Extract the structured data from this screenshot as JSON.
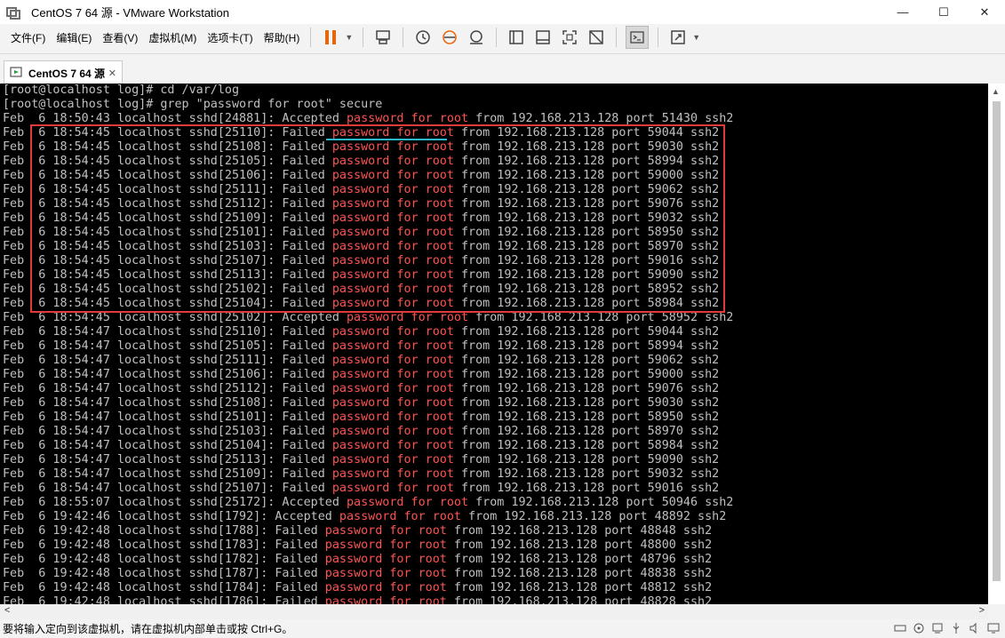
{
  "window": {
    "title": "CentOS 7 64 源 - VMware Workstation",
    "minimize_glyph": "—",
    "maximize_glyph": "☐",
    "close_glyph": "✕"
  },
  "menu": {
    "items": [
      "文件(F)",
      "编辑(E)",
      "查看(V)",
      "虚拟机(M)",
      "选项卡(T)",
      "帮助(H)"
    ]
  },
  "toolbar": {
    "dropdown_glyph": "▼"
  },
  "tab": {
    "label": "CentOS 7 64 源",
    "close": "✕"
  },
  "terminal": {
    "highlight_phrase": "password for root",
    "lines": [
      "[root@localhost log]# cd /var/log",
      "[root@localhost log]# grep \"password for root\" secure",
      "Feb  6 18:50:43 localhost sshd[24881]: Accepted password for root from 192.168.213.128 port 51430 ssh2",
      "Feb  6 18:54:45 localhost sshd[25110]: Failed password for root from 192.168.213.128 port 59044 ssh2",
      "Feb  6 18:54:45 localhost sshd[25108]: Failed password for root from 192.168.213.128 port 59030 ssh2",
      "Feb  6 18:54:45 localhost sshd[25105]: Failed password for root from 192.168.213.128 port 58994 ssh2",
      "Feb  6 18:54:45 localhost sshd[25106]: Failed password for root from 192.168.213.128 port 59000 ssh2",
      "Feb  6 18:54:45 localhost sshd[25111]: Failed password for root from 192.168.213.128 port 59062 ssh2",
      "Feb  6 18:54:45 localhost sshd[25112]: Failed password for root from 192.168.213.128 port 59076 ssh2",
      "Feb  6 18:54:45 localhost sshd[25109]: Failed password for root from 192.168.213.128 port 59032 ssh2",
      "Feb  6 18:54:45 localhost sshd[25101]: Failed password for root from 192.168.213.128 port 58950 ssh2",
      "Feb  6 18:54:45 localhost sshd[25103]: Failed password for root from 192.168.213.128 port 58970 ssh2",
      "Feb  6 18:54:45 localhost sshd[25107]: Failed password for root from 192.168.213.128 port 59016 ssh2",
      "Feb  6 18:54:45 localhost sshd[25113]: Failed password for root from 192.168.213.128 port 59090 ssh2",
      "Feb  6 18:54:45 localhost sshd[25102]: Failed password for root from 192.168.213.128 port 58952 ssh2",
      "Feb  6 18:54:45 localhost sshd[25104]: Failed password for root from 192.168.213.128 port 58984 ssh2",
      "Feb  6 18:54:45 localhost sshd[25102]: Accepted password for root from 192.168.213.128 port 58952 ssh2",
      "Feb  6 18:54:47 localhost sshd[25110]: Failed password for root from 192.168.213.128 port 59044 ssh2",
      "Feb  6 18:54:47 localhost sshd[25105]: Failed password for root from 192.168.213.128 port 58994 ssh2",
      "Feb  6 18:54:47 localhost sshd[25111]: Failed password for root from 192.168.213.128 port 59062 ssh2",
      "Feb  6 18:54:47 localhost sshd[25106]: Failed password for root from 192.168.213.128 port 59000 ssh2",
      "Feb  6 18:54:47 localhost sshd[25112]: Failed password for root from 192.168.213.128 port 59076 ssh2",
      "Feb  6 18:54:47 localhost sshd[25108]: Failed password for root from 192.168.213.128 port 59030 ssh2",
      "Feb  6 18:54:47 localhost sshd[25101]: Failed password for root from 192.168.213.128 port 58950 ssh2",
      "Feb  6 18:54:47 localhost sshd[25103]: Failed password for root from 192.168.213.128 port 58970 ssh2",
      "Feb  6 18:54:47 localhost sshd[25104]: Failed password for root from 192.168.213.128 port 58984 ssh2",
      "Feb  6 18:54:47 localhost sshd[25113]: Failed password for root from 192.168.213.128 port 59090 ssh2",
      "Feb  6 18:54:47 localhost sshd[25109]: Failed password for root from 192.168.213.128 port 59032 ssh2",
      "Feb  6 18:54:47 localhost sshd[25107]: Failed password for root from 192.168.213.128 port 59016 ssh2",
      "Feb  6 18:55:07 localhost sshd[25172]: Accepted password for root from 192.168.213.128 port 50946 ssh2",
      "Feb  6 19:42:46 localhost sshd[1792]: Accepted password for root from 192.168.213.128 port 48892 ssh2",
      "Feb  6 19:42:48 localhost sshd[1788]: Failed password for root from 192.168.213.128 port 48848 ssh2",
      "Feb  6 19:42:48 localhost sshd[1783]: Failed password for root from 192.168.213.128 port 48800 ssh2",
      "Feb  6 19:42:48 localhost sshd[1782]: Failed password for root from 192.168.213.128 port 48796 ssh2",
      "Feb  6 19:42:48 localhost sshd[1787]: Failed password for root from 192.168.213.128 port 48838 ssh2",
      "Feb  6 19:42:48 localhost sshd[1784]: Failed password for root from 192.168.213.128 port 48812 ssh2",
      "Feb  6 19:42:48 localhost sshd[1786]: Failed password for root from 192.168.213.128 port 48828 ssh2"
    ]
  },
  "scrollbars": {
    "up_glyph": "▲",
    "left_glyph": "<",
    "right_glyph": ">"
  },
  "status": {
    "text": "要将输入定向到该虚拟机，请在虚拟机内部单击或按 Ctrl+G。"
  },
  "colors": {
    "terminal_bg": "#000000",
    "terminal_fg": "#c0c0c0",
    "highlight": "#ff5353",
    "annotation_box": "#e03a3a",
    "annotation_underline": "#2bb8c8",
    "pause_icon": "#e8650a"
  }
}
